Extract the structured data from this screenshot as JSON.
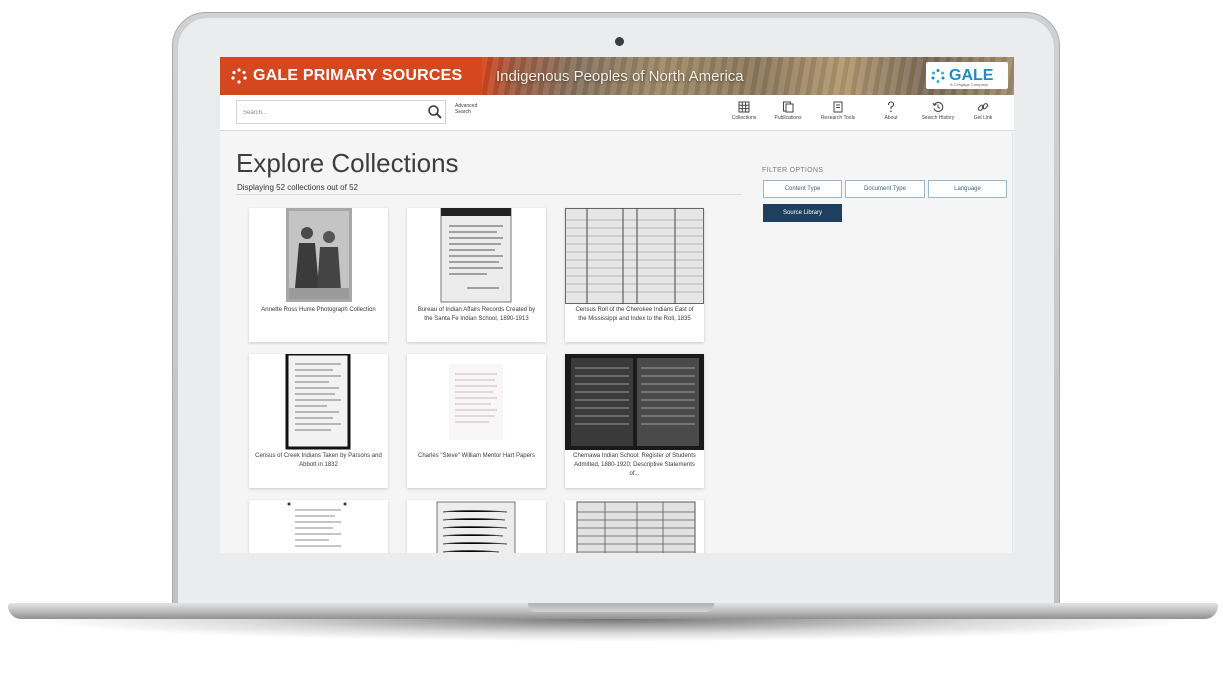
{
  "banner": {
    "brand": "GALE PRIMARY SOURCES",
    "collection_title": "Indigenous Peoples of North America",
    "logo_text": "GALE",
    "logo_subtext": "A Cengage Company",
    "brand_color": "#d5471e"
  },
  "toolbar": {
    "search_placeholder": "Search...",
    "advanced_search": "Advanced Search",
    "items": [
      {
        "label": "Collections",
        "icon": "collections-icon"
      },
      {
        "label": "Publications",
        "icon": "publications-icon"
      },
      {
        "label": "Research Tools",
        "icon": "research-tools-icon"
      },
      {
        "label": "About",
        "icon": "about-icon"
      },
      {
        "label": "Search History",
        "icon": "search-history-icon"
      },
      {
        "label": "Get Link",
        "icon": "get-link-icon"
      }
    ]
  },
  "main": {
    "title": "Explore Collections",
    "display_count": "Displaying 52 collections out of 52",
    "cards": [
      {
        "caption": "Annette Ross Hume Photograph Collection"
      },
      {
        "caption": "Bureau of Indian Affairs Records Created by the Santa Fe Indian School, 1890-1913"
      },
      {
        "caption": "Census Roll of the Cherokee Indians East of the Mississippi and Index to the Roll, 1835"
      },
      {
        "caption": "Census of Creek Indians Taken by Parsons and Abbott in 1832"
      },
      {
        "caption": "Charles \"Steve\" William Mentor Hart Papers"
      },
      {
        "caption": "Chemawa Indian School: Register of Students Admitted, 1880-1920; Descriptive Statements of..."
      },
      {
        "caption": ""
      },
      {
        "caption": ""
      },
      {
        "caption": ""
      }
    ]
  },
  "filters": {
    "label": "FILTER OPTIONS",
    "options": [
      "Content Type",
      "Document Type",
      "Language"
    ],
    "active": "Source Library",
    "active_color": "#1f3f5e"
  }
}
